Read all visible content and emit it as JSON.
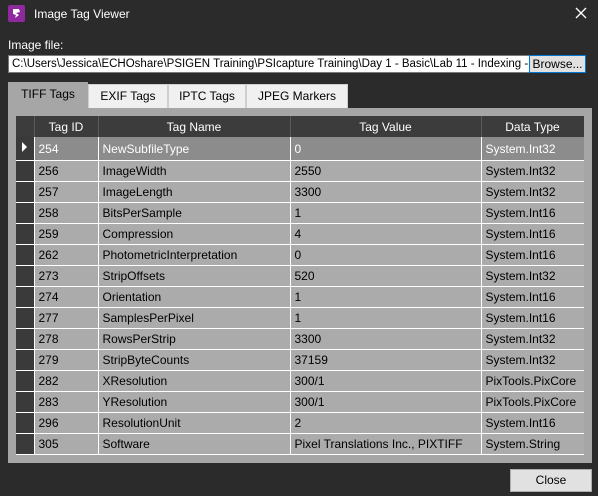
{
  "window": {
    "title": "Image Tag Viewer",
    "icon": "app-logo-icon",
    "close_icon": "close-icon"
  },
  "file": {
    "label": "Image file:",
    "path": "C:\\Users\\Jessica\\ECHOshare\\PSIGEN Training\\PSIcapture Training\\Day 1 - Basic\\Lab 11 - Indexing -",
    "browse_label": "Browse..."
  },
  "tabs": [
    {
      "label": "TIFF Tags",
      "active": true
    },
    {
      "label": "EXIF Tags",
      "active": false
    },
    {
      "label": "IPTC Tags",
      "active": false
    },
    {
      "label": "JPEG Markers",
      "active": false
    }
  ],
  "table": {
    "columns": [
      "Tag ID",
      "Tag Name",
      "Tag Value",
      "Data Type"
    ],
    "rows": [
      [
        "254",
        "NewSubfileType",
        "0",
        "System.Int32"
      ],
      [
        "256",
        "ImageWidth",
        "2550",
        "System.Int32"
      ],
      [
        "257",
        "ImageLength",
        "3300",
        "System.Int32"
      ],
      [
        "258",
        "BitsPerSample",
        "1",
        "System.Int16"
      ],
      [
        "259",
        "Compression",
        "4",
        "System.Int16"
      ],
      [
        "262",
        "PhotometricInterpretation",
        "0",
        "System.Int16"
      ],
      [
        "273",
        "StripOffsets",
        "520",
        "System.Int32"
      ],
      [
        "274",
        "Orientation",
        "1",
        "System.Int16"
      ],
      [
        "277",
        "SamplesPerPixel",
        "1",
        "System.Int16"
      ],
      [
        "278",
        "RowsPerStrip",
        "3300",
        "System.Int32"
      ],
      [
        "279",
        "StripByteCounts",
        "37159",
        "System.Int32"
      ],
      [
        "282",
        "XResolution",
        "300/1",
        "PixTools.PixCore"
      ],
      [
        "283",
        "YResolution",
        "300/1",
        "PixTools.PixCore"
      ],
      [
        "296",
        "ResolutionUnit",
        "2",
        "System.Int16"
      ],
      [
        "305",
        "Software",
        "Pixel Translations Inc., PIXTIFF",
        "System.String"
      ]
    ],
    "selected_row": 0
  },
  "footer": {
    "close_label": "Close"
  }
}
